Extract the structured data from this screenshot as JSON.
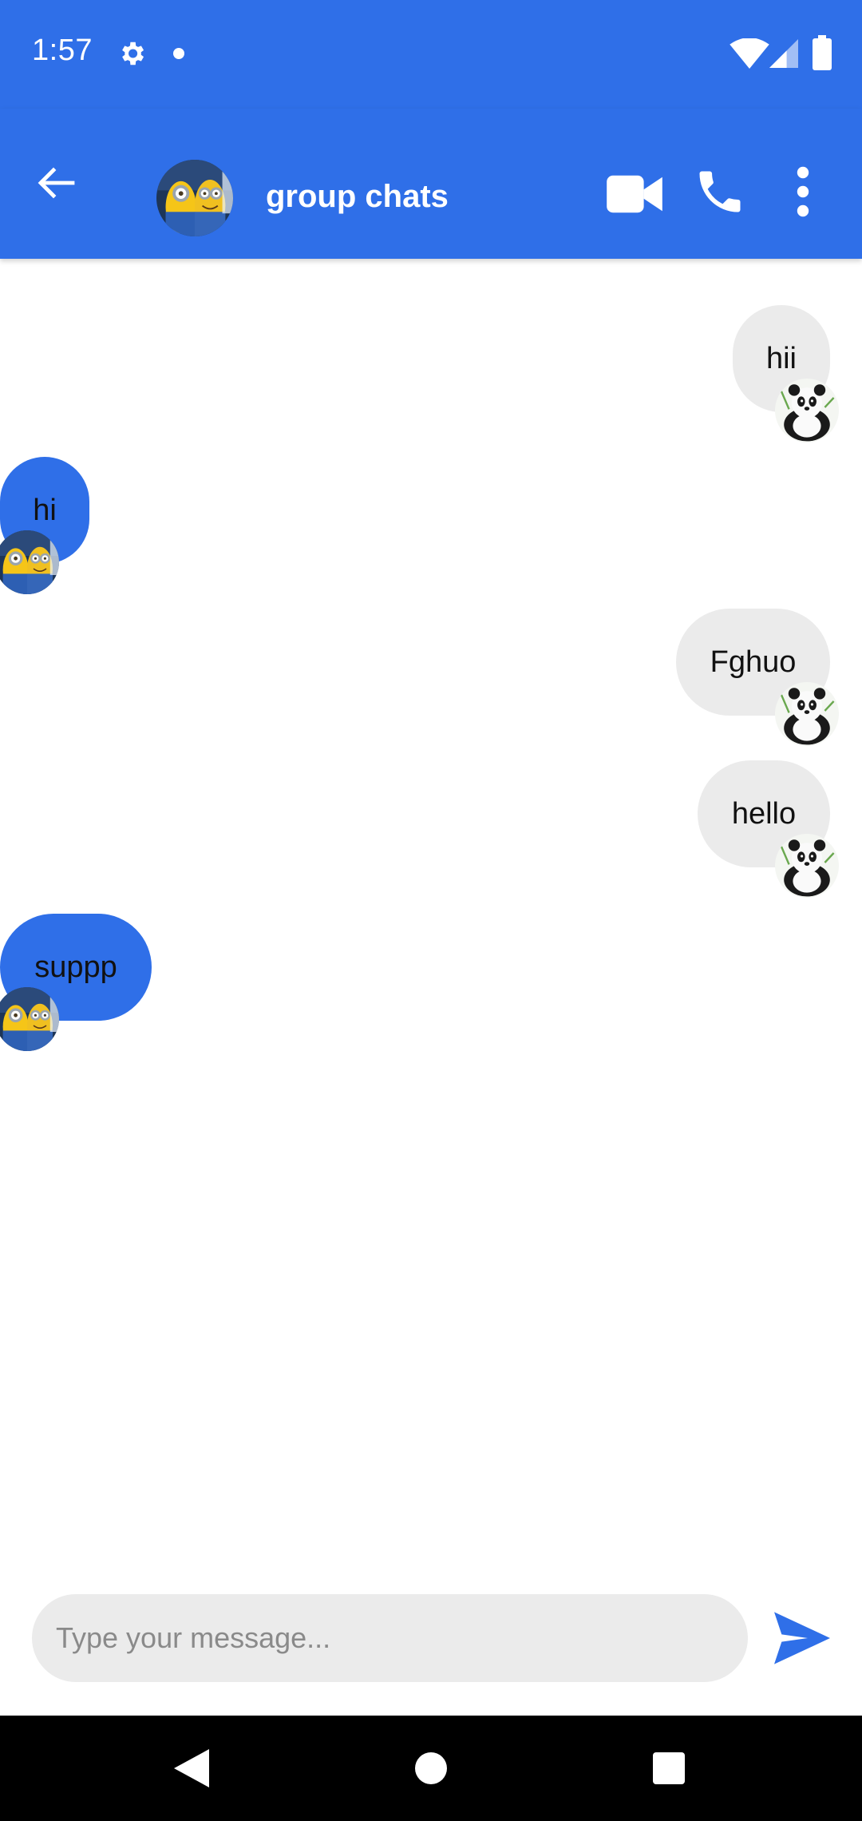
{
  "status_bar": {
    "time": "1:57",
    "icons": [
      "gear-icon",
      "notification-dot-icon",
      "wifi-icon",
      "cell-signal-icon",
      "battery-icon"
    ]
  },
  "app_bar": {
    "title": "group chats",
    "back_icon": "arrow-left-icon",
    "avatar": "minions-avatar",
    "actions": [
      "video-call-icon",
      "phone-icon",
      "more-vert-icon"
    ]
  },
  "messages": [
    {
      "text": "hii",
      "direction": "outgoing",
      "avatar": "panda-avatar"
    },
    {
      "text": "hi",
      "direction": "incoming",
      "avatar": "minions-avatar"
    },
    {
      "text": "Fghuo",
      "direction": "outgoing",
      "avatar": "panda-avatar"
    },
    {
      "text": "hello",
      "direction": "outgoing",
      "avatar": "panda-avatar"
    },
    {
      "text": "suppp",
      "direction": "incoming",
      "avatar": "minions-avatar"
    }
  ],
  "composer": {
    "placeholder": "Type your message...",
    "value": "",
    "send_icon": "send-icon"
  },
  "nav_bar": {
    "icons": [
      "nav-back-icon",
      "nav-home-icon",
      "nav-recents-icon"
    ]
  },
  "colors": {
    "primary": "#2f6fe8",
    "outgoing_bubble": "#ebebeb",
    "incoming_bubble": "#2f6fe8",
    "text": "#111111",
    "nav_bar": "#000000"
  }
}
